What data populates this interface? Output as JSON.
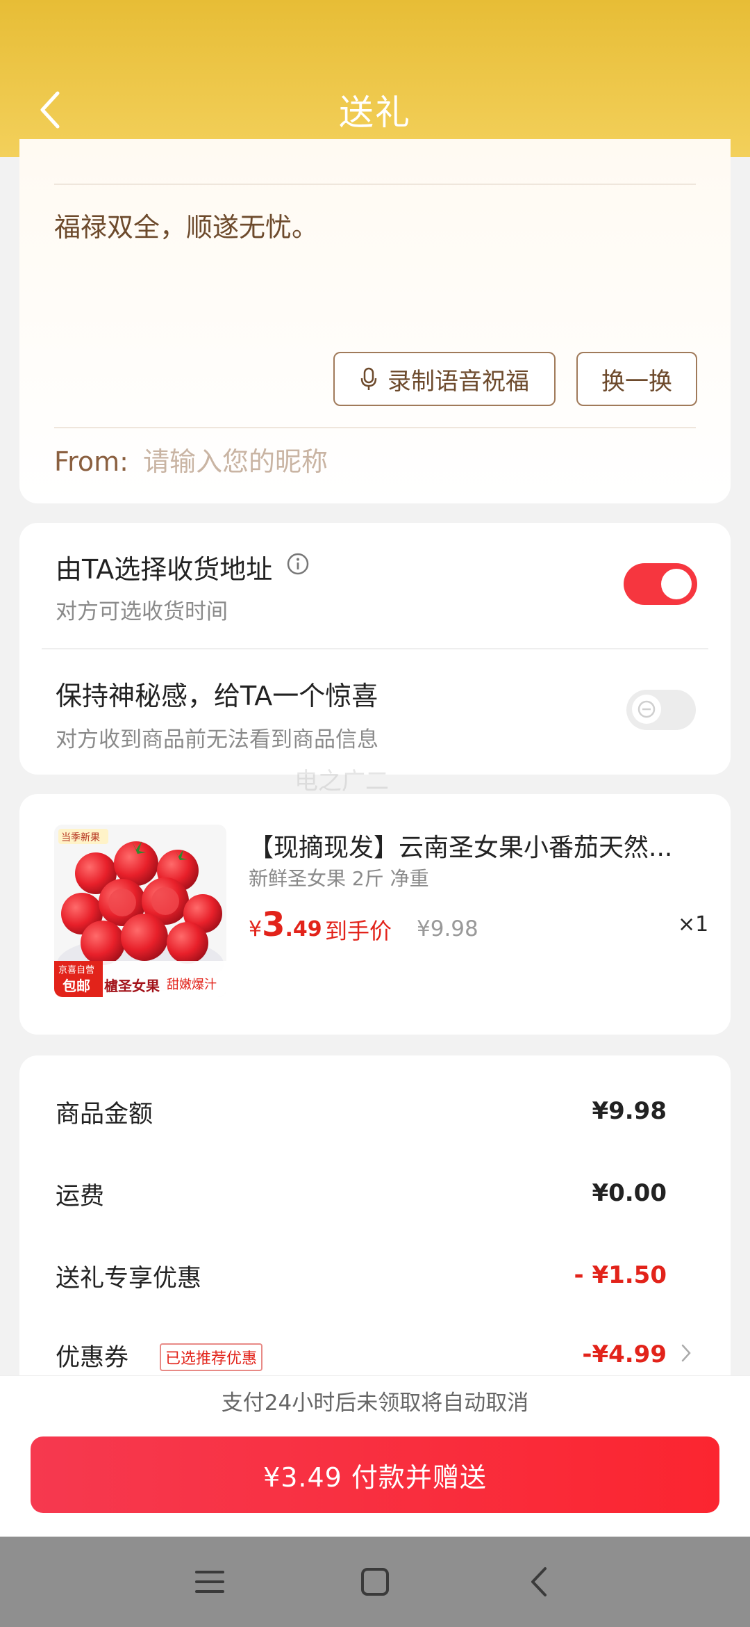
{
  "header": {
    "title": "送礼"
  },
  "message": {
    "blessing": "福禄双全，顺遂无忧。",
    "voice_button": "录制语音祝福",
    "swap_button": "换一换",
    "from_label": "From:",
    "from_placeholder": "请输入您的昵称"
  },
  "options": [
    {
      "title": "由TA选择收货地址",
      "subtitle": "对方可选收货时间",
      "enabled": true
    },
    {
      "title": "保持神秘感，给TA一个惊喜",
      "subtitle": "对方收到商品前无法看到商品信息",
      "enabled": false
    }
  ],
  "watermark": "电之广二",
  "product": {
    "title": "【现摘现发】云南圣女果小番茄天然...",
    "subtitle": "新鲜圣女果 2斤 净重",
    "price_symbol": "¥",
    "price_int": "3",
    "price_dec": ".49",
    "price_tag": "到手价",
    "original_price": "¥9.98",
    "quantity": "×1",
    "image_badges": {
      "season": "当季新果",
      "store": "京喜自营",
      "shipping": "包邮",
      "name": "樝圣女果",
      "slogan": "甜嫩爆汁"
    }
  },
  "summary": [
    {
      "label": "商品金额",
      "value": "¥9.98"
    },
    {
      "label": "运费",
      "value": "¥0.00"
    },
    {
      "label": "送礼专享优惠",
      "value": "- ¥1.50"
    },
    {
      "label": "优惠券",
      "badge": "已选推荐优惠",
      "value": "-¥4.99"
    }
  ],
  "notice": "支付24小时后未领取将自动取消",
  "pay_button": "¥3.49 付款并赠送",
  "colors": {
    "header": "#e7bd36",
    "accent": "#e2231a",
    "toggle_on": "#f6363f"
  }
}
